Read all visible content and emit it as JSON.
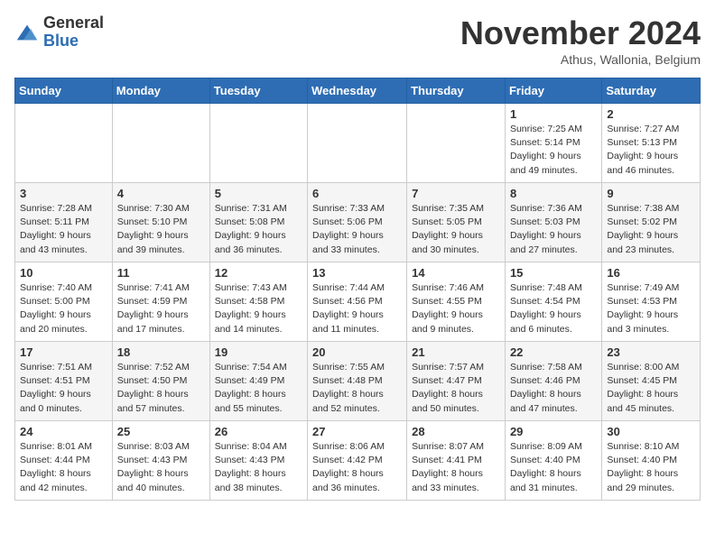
{
  "header": {
    "logo": {
      "general": "General",
      "blue": "Blue"
    },
    "month": "November 2024",
    "location": "Athus, Wallonia, Belgium"
  },
  "weekdays": [
    "Sunday",
    "Monday",
    "Tuesday",
    "Wednesday",
    "Thursday",
    "Friday",
    "Saturday"
  ],
  "weeks": [
    [
      {
        "day": "",
        "info": ""
      },
      {
        "day": "",
        "info": ""
      },
      {
        "day": "",
        "info": ""
      },
      {
        "day": "",
        "info": ""
      },
      {
        "day": "",
        "info": ""
      },
      {
        "day": "1",
        "info": "Sunrise: 7:25 AM\nSunset: 5:14 PM\nDaylight: 9 hours and 49 minutes."
      },
      {
        "day": "2",
        "info": "Sunrise: 7:27 AM\nSunset: 5:13 PM\nDaylight: 9 hours and 46 minutes."
      }
    ],
    [
      {
        "day": "3",
        "info": "Sunrise: 7:28 AM\nSunset: 5:11 PM\nDaylight: 9 hours and 43 minutes."
      },
      {
        "day": "4",
        "info": "Sunrise: 7:30 AM\nSunset: 5:10 PM\nDaylight: 9 hours and 39 minutes."
      },
      {
        "day": "5",
        "info": "Sunrise: 7:31 AM\nSunset: 5:08 PM\nDaylight: 9 hours and 36 minutes."
      },
      {
        "day": "6",
        "info": "Sunrise: 7:33 AM\nSunset: 5:06 PM\nDaylight: 9 hours and 33 minutes."
      },
      {
        "day": "7",
        "info": "Sunrise: 7:35 AM\nSunset: 5:05 PM\nDaylight: 9 hours and 30 minutes."
      },
      {
        "day": "8",
        "info": "Sunrise: 7:36 AM\nSunset: 5:03 PM\nDaylight: 9 hours and 27 minutes."
      },
      {
        "day": "9",
        "info": "Sunrise: 7:38 AM\nSunset: 5:02 PM\nDaylight: 9 hours and 23 minutes."
      }
    ],
    [
      {
        "day": "10",
        "info": "Sunrise: 7:40 AM\nSunset: 5:00 PM\nDaylight: 9 hours and 20 minutes."
      },
      {
        "day": "11",
        "info": "Sunrise: 7:41 AM\nSunset: 4:59 PM\nDaylight: 9 hours and 17 minutes."
      },
      {
        "day": "12",
        "info": "Sunrise: 7:43 AM\nSunset: 4:58 PM\nDaylight: 9 hours and 14 minutes."
      },
      {
        "day": "13",
        "info": "Sunrise: 7:44 AM\nSunset: 4:56 PM\nDaylight: 9 hours and 11 minutes."
      },
      {
        "day": "14",
        "info": "Sunrise: 7:46 AM\nSunset: 4:55 PM\nDaylight: 9 hours and 9 minutes."
      },
      {
        "day": "15",
        "info": "Sunrise: 7:48 AM\nSunset: 4:54 PM\nDaylight: 9 hours and 6 minutes."
      },
      {
        "day": "16",
        "info": "Sunrise: 7:49 AM\nSunset: 4:53 PM\nDaylight: 9 hours and 3 minutes."
      }
    ],
    [
      {
        "day": "17",
        "info": "Sunrise: 7:51 AM\nSunset: 4:51 PM\nDaylight: 9 hours and 0 minutes."
      },
      {
        "day": "18",
        "info": "Sunrise: 7:52 AM\nSunset: 4:50 PM\nDaylight: 8 hours and 57 minutes."
      },
      {
        "day": "19",
        "info": "Sunrise: 7:54 AM\nSunset: 4:49 PM\nDaylight: 8 hours and 55 minutes."
      },
      {
        "day": "20",
        "info": "Sunrise: 7:55 AM\nSunset: 4:48 PM\nDaylight: 8 hours and 52 minutes."
      },
      {
        "day": "21",
        "info": "Sunrise: 7:57 AM\nSunset: 4:47 PM\nDaylight: 8 hours and 50 minutes."
      },
      {
        "day": "22",
        "info": "Sunrise: 7:58 AM\nSunset: 4:46 PM\nDaylight: 8 hours and 47 minutes."
      },
      {
        "day": "23",
        "info": "Sunrise: 8:00 AM\nSunset: 4:45 PM\nDaylight: 8 hours and 45 minutes."
      }
    ],
    [
      {
        "day": "24",
        "info": "Sunrise: 8:01 AM\nSunset: 4:44 PM\nDaylight: 8 hours and 42 minutes."
      },
      {
        "day": "25",
        "info": "Sunrise: 8:03 AM\nSunset: 4:43 PM\nDaylight: 8 hours and 40 minutes."
      },
      {
        "day": "26",
        "info": "Sunrise: 8:04 AM\nSunset: 4:43 PM\nDaylight: 8 hours and 38 minutes."
      },
      {
        "day": "27",
        "info": "Sunrise: 8:06 AM\nSunset: 4:42 PM\nDaylight: 8 hours and 36 minutes."
      },
      {
        "day": "28",
        "info": "Sunrise: 8:07 AM\nSunset: 4:41 PM\nDaylight: 8 hours and 33 minutes."
      },
      {
        "day": "29",
        "info": "Sunrise: 8:09 AM\nSunset: 4:40 PM\nDaylight: 8 hours and 31 minutes."
      },
      {
        "day": "30",
        "info": "Sunrise: 8:10 AM\nSunset: 4:40 PM\nDaylight: 8 hours and 29 minutes."
      }
    ]
  ]
}
